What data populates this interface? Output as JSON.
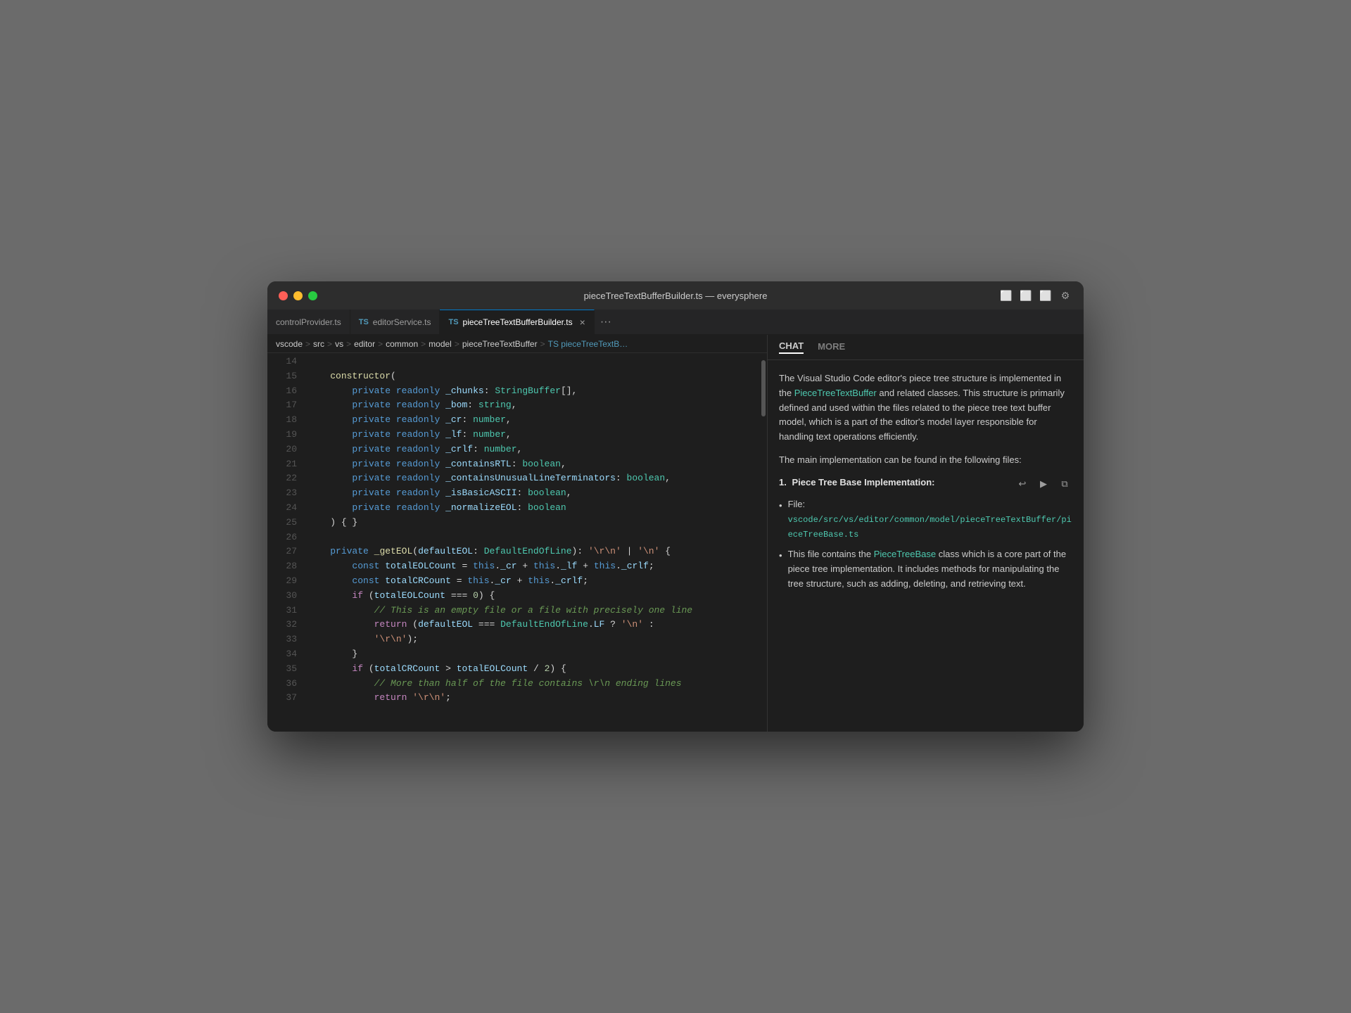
{
  "window": {
    "title": "pieceTreeTextBufferBuilder.ts — everysphere"
  },
  "titlebar": {
    "title": "pieceTreeTextBufferBuilder.ts — everysphere",
    "traffic_lights": [
      "red",
      "yellow",
      "green"
    ],
    "icons": [
      "split-left",
      "split-horizontal",
      "split-right",
      "settings"
    ]
  },
  "tabs": [
    {
      "id": "tab1",
      "label": "controlProvider.ts",
      "ts": false,
      "active": false,
      "closable": false
    },
    {
      "id": "tab2",
      "label": "editorService.ts",
      "ts": true,
      "active": false,
      "closable": false
    },
    {
      "id": "tab3",
      "label": "pieceTreeTextBufferBuilder.ts",
      "ts": true,
      "active": true,
      "closable": true
    }
  ],
  "breadcrumb": {
    "items": [
      "vscode",
      "src",
      "vs",
      "editor",
      "common",
      "model",
      "pieceTreeTextBuffer",
      "TS pieceTreeTextB..."
    ]
  },
  "code": {
    "lines": [
      {
        "num": "14",
        "content": ""
      },
      {
        "num": "15",
        "content": "constructor("
      },
      {
        "num": "16",
        "content": "    private readonly _chunks: StringBuffer[],"
      },
      {
        "num": "17",
        "content": "    private readonly _bom: string,"
      },
      {
        "num": "18",
        "content": "    private readonly _cr: number,"
      },
      {
        "num": "19",
        "content": "    private readonly _lf: number,"
      },
      {
        "num": "20",
        "content": "    private readonly _crlf: number,"
      },
      {
        "num": "21",
        "content": "    private readonly _containsRTL: boolean,"
      },
      {
        "num": "22",
        "content": "    private readonly _containsUnusualLineTerminators: boolean,"
      },
      {
        "num": "23",
        "content": "    private readonly _isBasicASCII: boolean,"
      },
      {
        "num": "24",
        "content": "    private readonly _normalizeEOL: boolean"
      },
      {
        "num": "25",
        "content": ") { }"
      },
      {
        "num": "26",
        "content": ""
      },
      {
        "num": "27",
        "content": "private _getEOL(defaultEOL: DefaultEndOfLine): '\\r\\n' | '\\n' {"
      },
      {
        "num": "28",
        "content": "    const totalEOLCount = this._cr + this._lf + this._crlf;"
      },
      {
        "num": "29",
        "content": "    const totalCRCount = this._cr + this._crlf;"
      },
      {
        "num": "30",
        "content": "    if (totalEOLCount === 0) {"
      },
      {
        "num": "31",
        "content": "        // This is an empty file or a file with precisely one line"
      },
      {
        "num": "32",
        "content": "        return (defaultEOL === DefaultEndOfLine.LF ? '\\n' :"
      },
      {
        "num": "33",
        "content": "        '\\r\\n');"
      },
      {
        "num": "34",
        "content": "    }"
      },
      {
        "num": "35",
        "content": "    if (totalCRCount > totalEOLCount / 2) {"
      },
      {
        "num": "36",
        "content": "        // More than half of the file contains \\r\\n ending lines"
      },
      {
        "num": "37",
        "content": "        return '\\r\\n';"
      }
    ]
  },
  "chat": {
    "tabs": [
      {
        "id": "chat-tab",
        "label": "CHAT",
        "active": true
      },
      {
        "id": "more-tab",
        "label": "MORE",
        "active": false
      }
    ],
    "intro_text": "The Visual Studio Code editor's piece tree structure is implemented in the",
    "intro_link": "PieceTreeTextBuffer",
    "intro_text2": "and related classes. This structure is primarily defined and used within the files related to the piece tree text buffer model, which is a part of the editor's model layer responsible for handling text operations efficiently.",
    "main_text": "The main implementation can be found in the following files:",
    "section1": {
      "number": "1.",
      "title": "Piece Tree Base Implementation:",
      "file_bullet_label": "File:",
      "file_link": "vscode/src/vs/editor/common/model/pieceTreeTextBuffer/pieceTreeBase.ts",
      "description_link": "PieceTreeBase",
      "description": "class which is a core part of the piece tree implementation. It includes methods for manipulating the tree structure, such as adding, deleting, and retrieving text.",
      "description_prefix": "This file contains the"
    }
  }
}
